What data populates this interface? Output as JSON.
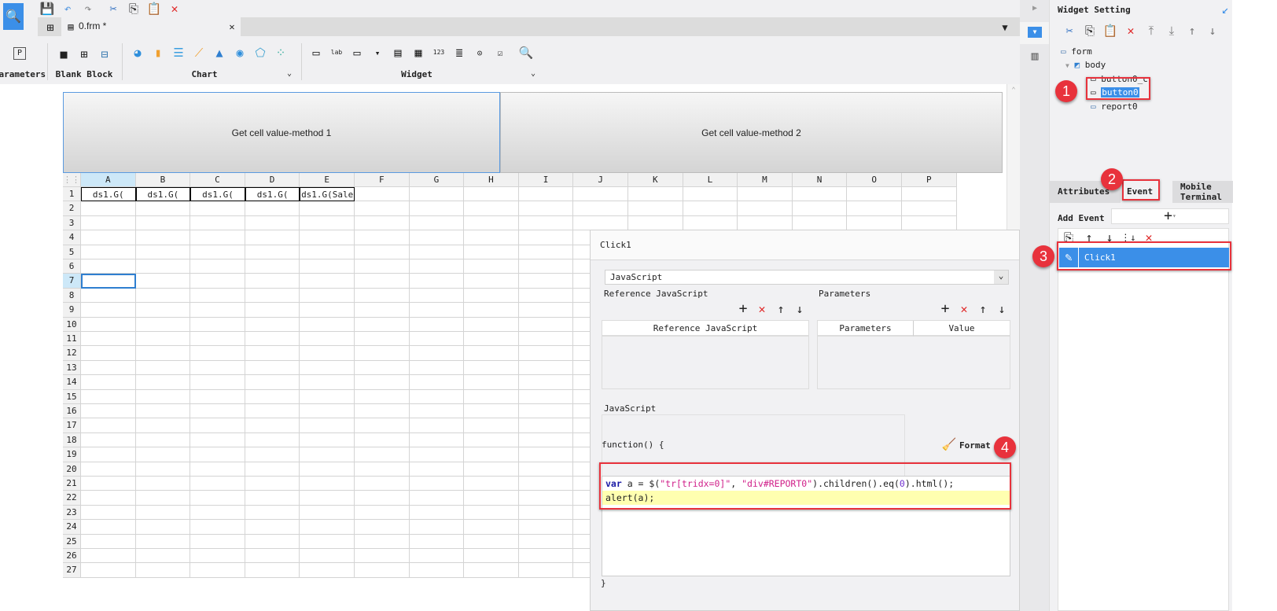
{
  "toolbar": {
    "tab_title": "0.frm *",
    "groups": {
      "parameters": "Parameters",
      "blank_block": "Blank Block",
      "chart": "Chart",
      "widget": "Widget"
    }
  },
  "canvas": {
    "button1": "Get cell value-method 1",
    "button2": "Get cell value-method 2",
    "columns": [
      "A",
      "B",
      "C",
      "D",
      "E",
      "F",
      "G",
      "H",
      "I",
      "J",
      "K",
      "L",
      "M",
      "N",
      "O",
      "P"
    ],
    "rows": [
      "1",
      "2",
      "3",
      "4",
      "5",
      "6",
      "7",
      "8",
      "9",
      "10",
      "11",
      "12",
      "13",
      "14",
      "15",
      "16",
      "17",
      "18",
      "19",
      "20",
      "21",
      "22",
      "23",
      "24",
      "25",
      "26",
      "27"
    ],
    "row1_cells": [
      "ds1.G(",
      "ds1.G(",
      "ds1.G(",
      "ds1.G(",
      "ds1.G(Sale"
    ]
  },
  "dialog": {
    "title": "Click1",
    "type_select": "JavaScript",
    "ref_js_section": "Reference JavaScript",
    "params_section": "Parameters",
    "ref_js_col": "Reference JavaScript",
    "params_col": "Parameters",
    "value_col": "Value",
    "js_section": "JavaScript",
    "function_open": "function() {",
    "format_label": "Format",
    "code_line1_kw": "var",
    "code_line1_a": " a = $(",
    "code_line1_s1": "\"tr[tridx=0]\"",
    "code_line1_b": ", ",
    "code_line1_s2": "\"div#REPORT0\"",
    "code_line1_c": ").children().eq(",
    "code_line1_n": "0",
    "code_line1_d": ").html();",
    "code_line2": "alert(a);",
    "function_close": "}"
  },
  "right_panel": {
    "title": "Widget Setting",
    "tree": {
      "form": "form",
      "body": "body",
      "button0_c": "button0_c",
      "button0": "button0",
      "report0": "report0"
    },
    "tabs": {
      "attributes": "Attributes",
      "event": "Event",
      "mobile": "Mobile Terminal"
    },
    "add_event": "Add Event",
    "event_item": "Click1"
  },
  "annotations": [
    "1",
    "2",
    "3",
    "4"
  ],
  "colors": {
    "accent": "#3b8fe8",
    "highlight": "#e8323c"
  }
}
